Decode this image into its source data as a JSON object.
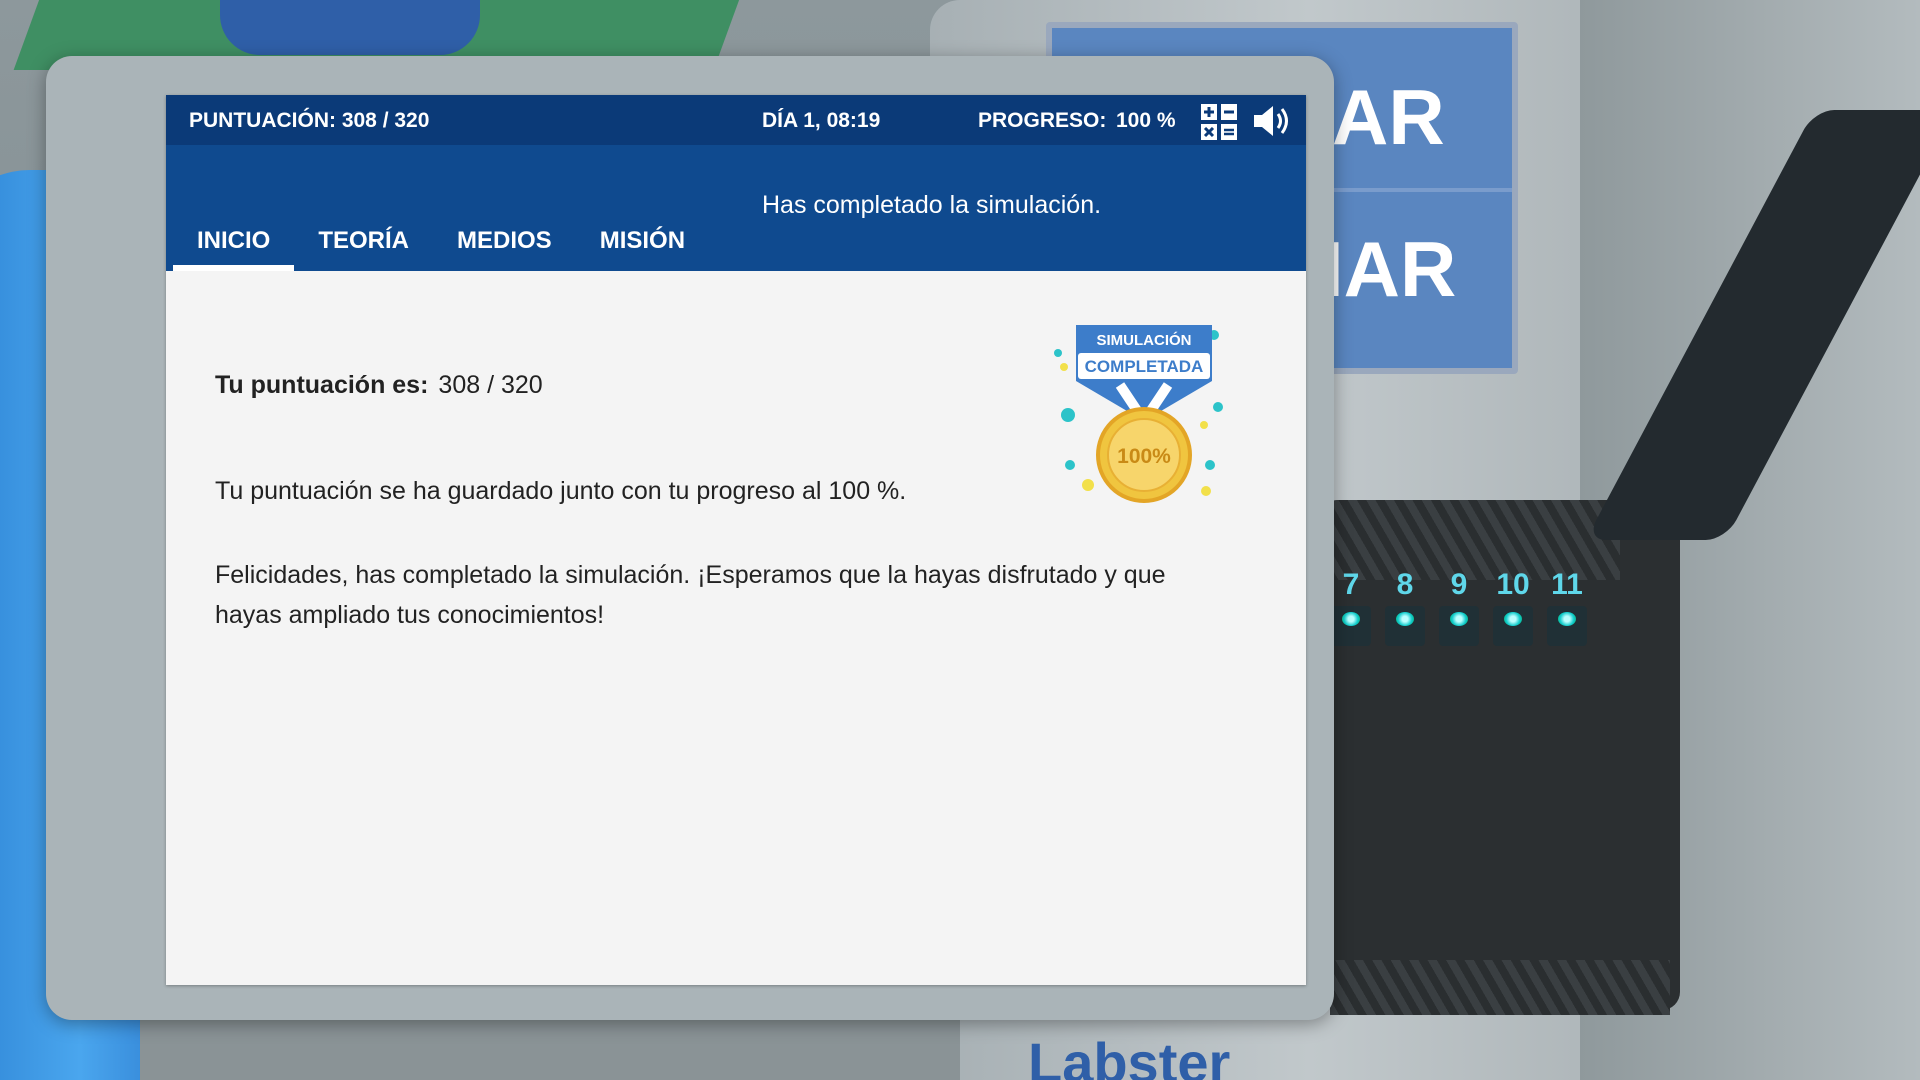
{
  "topbar": {
    "score": "PUNTUACIÓN: 308 / 320",
    "day": "DÍA 1, 08:19",
    "progress_label": "PROGRESO:",
    "progress_value": "100 %"
  },
  "header": {
    "notice": "Has completado la simulación."
  },
  "tabs": [
    {
      "label": "INICIO",
      "active": true
    },
    {
      "label": "TEORÍA",
      "active": false
    },
    {
      "label": "MEDIOS",
      "active": false
    },
    {
      "label": "MISIÓN",
      "active": false
    }
  ],
  "content": {
    "score_label": "Tu puntuación es:",
    "score_value": "308 / 320",
    "saved_text": "Tu puntuación se ha guardado junto con tu progreso al 100 %.",
    "congrats_text": "Felicidades, has completado la simulación. ¡Esperamos que la hayas disfrutado y que hayas ampliado tus conocimientos!"
  },
  "badge": {
    "line1": "SIMULACIÓN",
    "line2": "COMPLETADA",
    "medal": "100%"
  },
  "background": {
    "screen_text_1": "AR",
    "screen_text_2": "IAR",
    "slot_numbers": [
      "7",
      "8",
      "9",
      "10",
      "11"
    ],
    "brand": "Labster"
  },
  "icons": {
    "calculator": "calculator-icon",
    "sound": "speaker-icon"
  },
  "colors": {
    "topbar": "#0b3a78",
    "header": "#0f4a8f",
    "panel": "#f4f4f4",
    "slot_accent": "#5fd7ea"
  }
}
